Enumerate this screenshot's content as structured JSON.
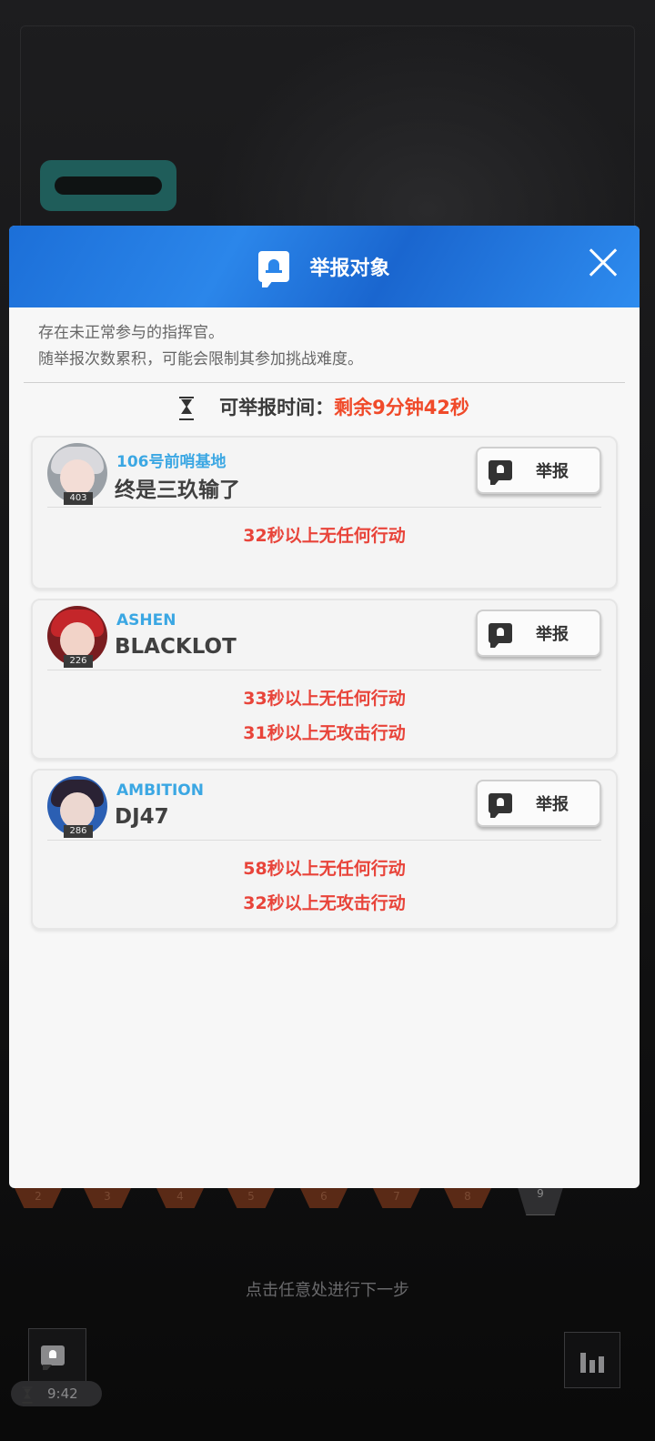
{
  "modal": {
    "title": "举报对象",
    "description_line1": "存在未正常参与的指挥官。",
    "description_line2": "随举报次数累积，可能会限制其参加挑战难度。",
    "time_label": "可举报时间：",
    "time_value": "剩余9分钟42秒"
  },
  "players": [
    {
      "base": "106号前哨基地",
      "name": "终是三玖输了",
      "level": "403",
      "report_label": "举报",
      "reasons": [
        "32秒以上无任何行动"
      ],
      "avatar_colors": {
        "hair": "#d9d9dd",
        "face": "#f3ddd6",
        "ring": "#9aa0a6"
      }
    },
    {
      "base": "ASHEN",
      "name": "BLACKLOT",
      "level": "226",
      "report_label": "举报",
      "reasons": [
        "33秒以上无任何行动",
        "31秒以上无攻击行动"
      ],
      "avatar_colors": {
        "hair": "#c4262a",
        "face": "#f2d3c8",
        "ring": "#c4262a"
      }
    },
    {
      "base": "AMBITION",
      "name": "DJ47",
      "level": "286",
      "report_label": "举报",
      "reasons": [
        "58秒以上无任何行动",
        "32秒以上无攻击行动"
      ],
      "avatar_colors": {
        "hair": "#2a2234",
        "face": "#ecd7d0",
        "ring": "#2b5fb3"
      }
    }
  ],
  "background": {
    "hint": "点击任意处进行下一步",
    "timer": "9:42",
    "stage_numbers": [
      "2",
      "3",
      "4",
      "5",
      "6",
      "7",
      "8",
      "9"
    ]
  },
  "colors": {
    "header_blue": "#2b86ea",
    "base_name": "#3ba7e3",
    "reason_red": "#e8443a",
    "time_orange": "#f04a2a"
  }
}
